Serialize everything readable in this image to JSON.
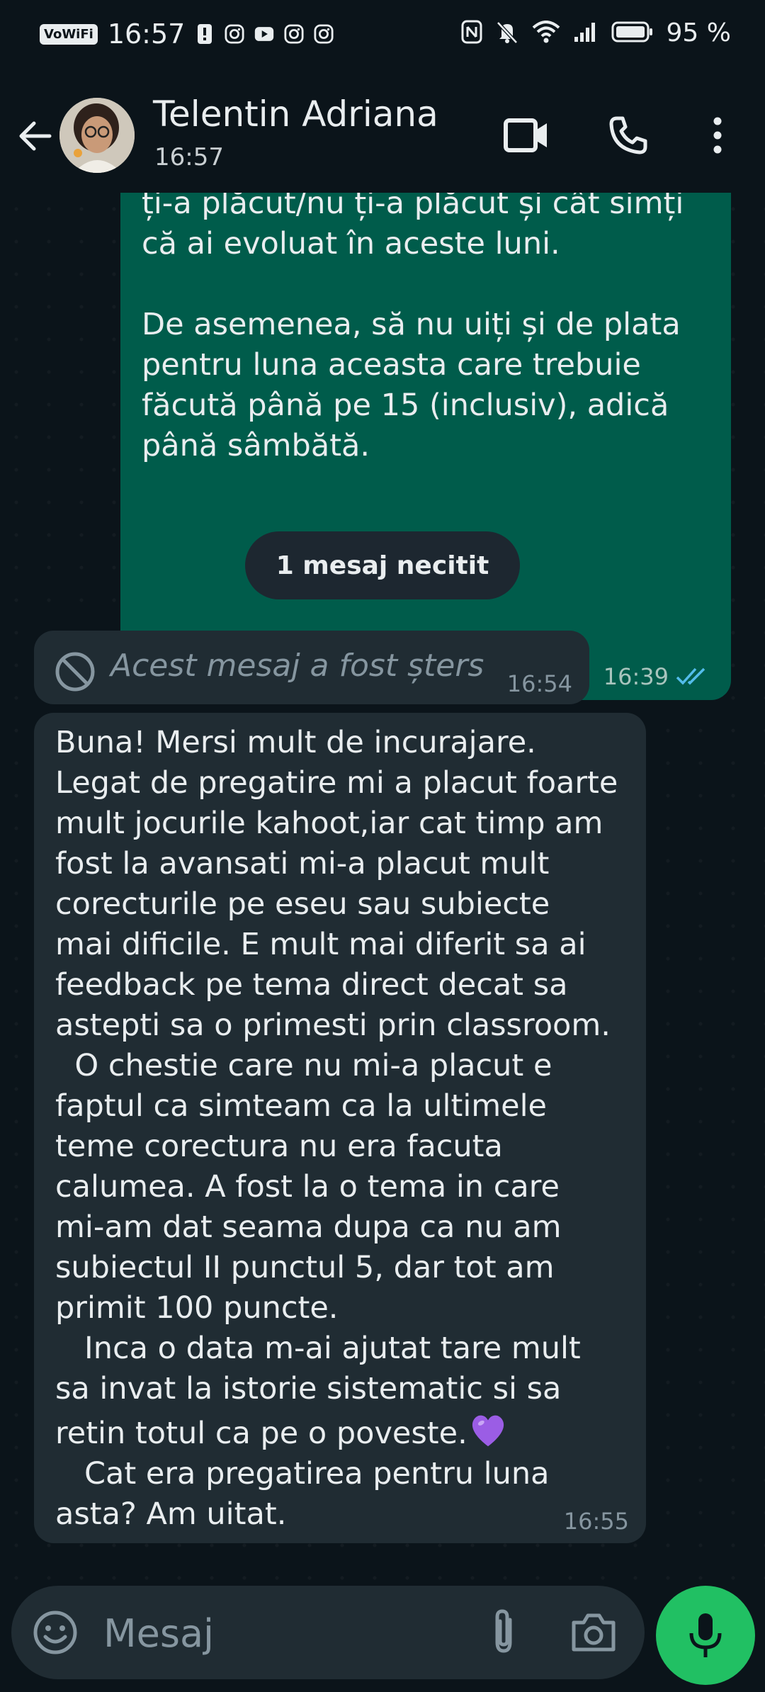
{
  "status_bar": {
    "vowifi": "VoWiFi",
    "time": "16:57",
    "battery_percent": "95 %",
    "left_icons": [
      "alert-icon",
      "instagram-icon",
      "youtube-icon",
      "instagram-icon",
      "instagram-icon"
    ],
    "right_icons": [
      "nfc-icon",
      "mute-icon",
      "wifi-icon",
      "signal-icon",
      "battery-icon"
    ]
  },
  "header": {
    "contact_name": "Telentin Adriana",
    "last_seen": "16:57"
  },
  "messages": {
    "outgoing": {
      "text": "legat de pregatire, cum a fost, ce\nți-a plăcut/nu ți-a plăcut și cât simți\ncă ai evoluat în aceste luni.\n\nDe asemenea, să nu uiți și de plata\npentru luna aceasta care trebuie\nfăcută până pe 15 (inclusiv), adică\npână sâmbătă.",
      "time": "16:39",
      "status": "read"
    },
    "unread_divider": "1 mesaj necitit",
    "deleted": {
      "text": "Acest mesaj a fost șters",
      "time": "16:54"
    },
    "incoming": {
      "text": "Buna! Mersi mult de incurajare.\nLegat de pregatire mi a placut foarte\nmult jocurile kahoot,iar cat timp am\nfost la avansati mi-a placut mult\ncorecturile pe eseu sau subiecte\nmai dificile. E mult mai diferit sa ai\nfeedback pe tema direct decat sa\nastepti sa o primesti prin classroom.\n  O chestie care nu mi-a placut e\nfaptul ca simteam ca la ultimele\nteme corectura nu era facuta\ncalumea. A fost la o tema in care\nmi-am dat seama dupa ca nu am\nsubiectul II punctul 5, dar tot am\nprimit 100 puncte.\n   Inca o data m-ai ajutat tare mult\nsa invat la istorie sistematic si sa\nretin totul ca pe o poveste.",
      "text_after_emoji": "\n   Cat era pregatirea pentru luna\nasta? Am uitat.",
      "emoji": "purple-heart",
      "time": "16:55"
    }
  },
  "composer": {
    "placeholder": "Mesaj"
  },
  "colors": {
    "background": "#0b141a",
    "outgoing_bubble": "#005c4b",
    "incoming_bubble": "#202c33",
    "accent_green": "#21c063",
    "read_ticks": "#53bdeb"
  }
}
